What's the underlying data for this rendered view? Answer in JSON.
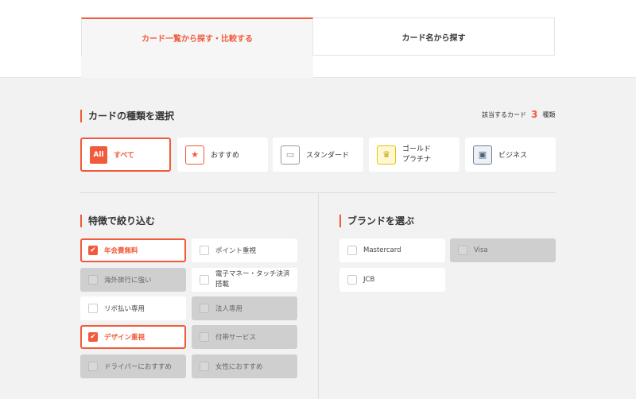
{
  "tabs": [
    {
      "label": "カード一覧から探す・比較する",
      "active": true
    },
    {
      "label": "カード名から探す",
      "active": false
    }
  ],
  "card_type": {
    "heading": "カードの種類を選択",
    "count_prefix": "該当するカード",
    "count": "3",
    "count_suffix": "種類",
    "options": [
      {
        "badge": "All",
        "label": "すべて",
        "icon": "all-badge",
        "selected": true
      },
      {
        "label": "おすすめ",
        "icon": "recommend-card-icon"
      },
      {
        "label": "スタンダード",
        "icon": "standard-card-icon"
      },
      {
        "label_line1": "ゴールド",
        "label_line2": "プラチナ",
        "icon": "gold-card-icon"
      },
      {
        "label": "ビジネス",
        "icon": "business-card-icon"
      }
    ]
  },
  "features": {
    "heading": "特徴で絞り込む",
    "items": [
      {
        "label": "年会費無料",
        "checked": true
      },
      {
        "label": "ポイント重視"
      },
      {
        "label": "海外旅行に強い",
        "disabled": true
      },
      {
        "label_line1": "電子マネー・タッチ決済",
        "label_line2": "搭載"
      },
      {
        "label": "リボ払い専用"
      },
      {
        "label": "法人専用",
        "disabled": true
      },
      {
        "label": "デザイン重視",
        "checked": true
      },
      {
        "label": "付帯サービス",
        "disabled": true
      },
      {
        "label": "ドライバーにおすすめ",
        "disabled": true
      },
      {
        "label": "女性におすすめ",
        "disabled": true
      }
    ]
  },
  "brands": {
    "heading": "ブランドを選ぶ",
    "items": [
      {
        "label": "Mastercard"
      },
      {
        "label": "Visa",
        "disabled": true
      },
      {
        "label": "JCB"
      }
    ]
  },
  "colors": {
    "accent": "#f15a3b",
    "disabled": "#cfcfcf"
  }
}
